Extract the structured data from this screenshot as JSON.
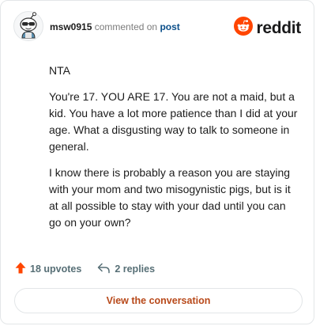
{
  "comment": {
    "username": "msw0915",
    "action_text": "commented on",
    "post_link": "post",
    "paragraphs": [
      "NTA",
      "You're 17. YOU ARE 17. You are not a maid, but a kid. You have a lot more patience than I did at your age. What a disgusting way to talk to someone in general.",
      "I know there is probably a reason you are staying with your mom and two misogynistic pigs, but is it at all possible to stay with your dad until you can go on your own?"
    ],
    "upvotes": "18 upvotes",
    "replies": "2 replies"
  },
  "brand": {
    "name": "reddit",
    "color": "#ff4500"
  },
  "cta": {
    "label": "View the conversation",
    "color": "#b8491a"
  },
  "icons": {
    "avatar": "snoo-avatar",
    "logo": "reddit-alien-icon",
    "upvote": "upvote-arrow-icon",
    "reply": "reply-arrow-icon"
  }
}
